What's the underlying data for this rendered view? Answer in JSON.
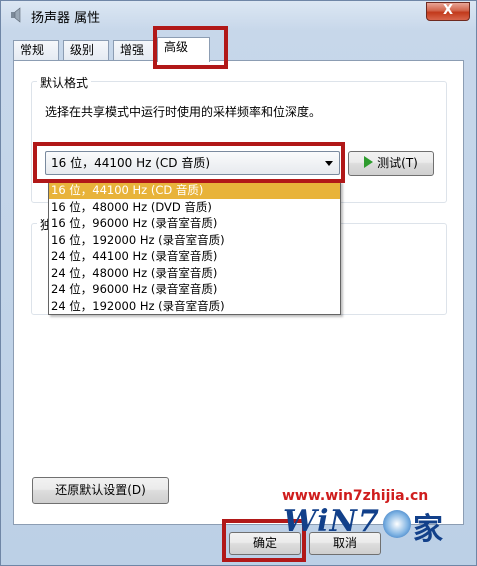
{
  "window": {
    "title": "扬声器 属性",
    "close_label": "X"
  },
  "tabs": [
    {
      "label": "常规"
    },
    {
      "label": "级别"
    },
    {
      "label": "增强"
    },
    {
      "label": "高级",
      "active": true
    }
  ],
  "default_format": {
    "group_label": "默认格式",
    "description": "选择在共享模式中运行时使用的采样频率和位深度。",
    "selected_value": "16 位，44100 Hz (CD 音质)",
    "test_button_label": "测试(T)",
    "options": [
      "16 位，44100 Hz (CD 音质)",
      "16 位，48000 Hz (DVD 音质)",
      "16 位，96000 Hz (录音室音质)",
      "16 位，192000 Hz (录音室音质)",
      "24 位，44100 Hz (录音室音质)",
      "24 位，48000 Hz (录音室音质)",
      "24 位，96000 Hz (录音室音质)",
      "24 位，192000 Hz (录音室音质)"
    ]
  },
  "exclusive_group": {
    "label_fragment": "独"
  },
  "restore_defaults_label": "还原默认设置(D)",
  "footer": {
    "ok_label": "确定",
    "cancel_label": "取消"
  },
  "watermark": {
    "url": "www.win7zhijia.cn",
    "logo_text": "WiN7",
    "logo_suffix": "家"
  },
  "colors": {
    "highlight_box": "#b11818",
    "selected_option": "#e8b33a",
    "watermark_red": "#cf1d1d",
    "logo_blue": "#12408a",
    "play_icon_green": "#2e9c2e"
  },
  "icons": {
    "title_icon": "speaker-icon",
    "test_icon": "play-icon"
  }
}
